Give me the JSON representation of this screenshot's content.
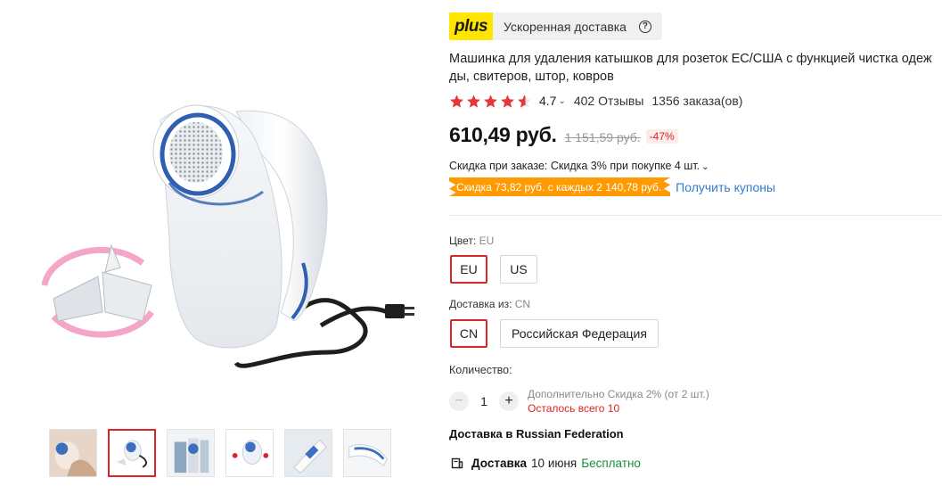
{
  "plus": {
    "logo": "plus",
    "label": "Ускоренная доставка",
    "help_glyph": "?"
  },
  "product": {
    "title": "Машинка для удаления катышков для розеток ЕС/США с функцией чистка одежды, свитеров, штор, ковров",
    "rating": "4.7",
    "rating_stars_fraction": 0.94,
    "reviews": "402 Отзывы",
    "orders": "1356 заказа(ов)"
  },
  "price": {
    "current": "610,49 руб.",
    "old": "1 151,59 руб.",
    "discount": "-47%"
  },
  "promos": {
    "order_discount": "Скидка при заказе: Скидка 3% при покупке 4 шт.",
    "coupon": "Скидка 73,82 руб. с каждых 2 140,78 руб.",
    "coupon_link": "Получить купоны"
  },
  "color": {
    "label": "Цвет:",
    "selected": "EU",
    "options": [
      "EU",
      "US"
    ]
  },
  "ship_from": {
    "label": "Доставка из:",
    "selected": "CN",
    "options": [
      "CN",
      "Российская Федерация"
    ]
  },
  "quantity": {
    "label": "Количество:",
    "value": "1",
    "minus": "−",
    "plus": "+",
    "note": "Дополнительно Скидка 2% (от 2 шт.)",
    "stock": "Осталось всего 10"
  },
  "delivery": {
    "heading": "Доставка в Russian Federation",
    "label": "Доставка",
    "date": "10 июня",
    "cost": "Бесплатно"
  },
  "colors": {
    "accent_red": "#d7262b",
    "plus_yellow": "#ffe500",
    "coupon_orange": "#ff9a00",
    "star_red": "#e5383b",
    "free_green": "#1a8f3c"
  },
  "icons": {
    "help": "question-circle-icon",
    "rating_chevron": "chevron-down-icon",
    "delivery": "truck-icon"
  }
}
